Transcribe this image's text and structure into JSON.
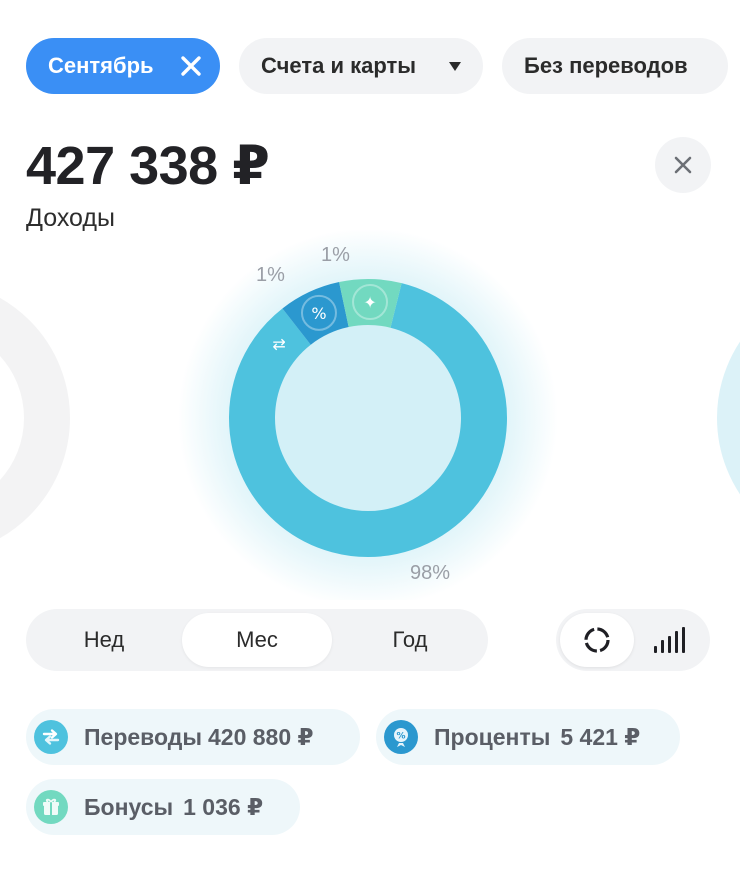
{
  "filters": {
    "month_label": "Сентябрь",
    "accounts_label": "Счета и карты",
    "transfers_label": "Без переводов"
  },
  "summary": {
    "total": "427 338 ₽",
    "type_label": "Доходы"
  },
  "chart_data": {
    "type": "pie",
    "style": "donut",
    "categories": [
      "Переводы",
      "Проценты",
      "Бонусы"
    ],
    "values": [
      420880,
      5421,
      1036
    ],
    "percent_labels": [
      "98%",
      "1%",
      "1%"
    ],
    "colors": [
      "#4ec2de",
      "#2b98cf",
      "#72d9c0"
    ],
    "icons": [
      "transfer-icon",
      "percent-icon",
      "gift-icon"
    ]
  },
  "period": {
    "options": [
      "Нед",
      "Мес",
      "Год"
    ],
    "selected": "Мес"
  },
  "view_modes": [
    "donut-icon",
    "bar-chart-icon"
  ],
  "legend": [
    {
      "label": "Переводы",
      "amount": "420 880 ₽",
      "icon": "transfer-icon",
      "color": "#4ec2de"
    },
    {
      "label": "Проценты",
      "amount": "5 421 ₽",
      "icon": "percent-icon",
      "color": "#2b98cf"
    },
    {
      "label": "Бонусы",
      "amount": "1 036 ₽",
      "icon": "gift-icon",
      "color": "#72d9c0"
    }
  ]
}
